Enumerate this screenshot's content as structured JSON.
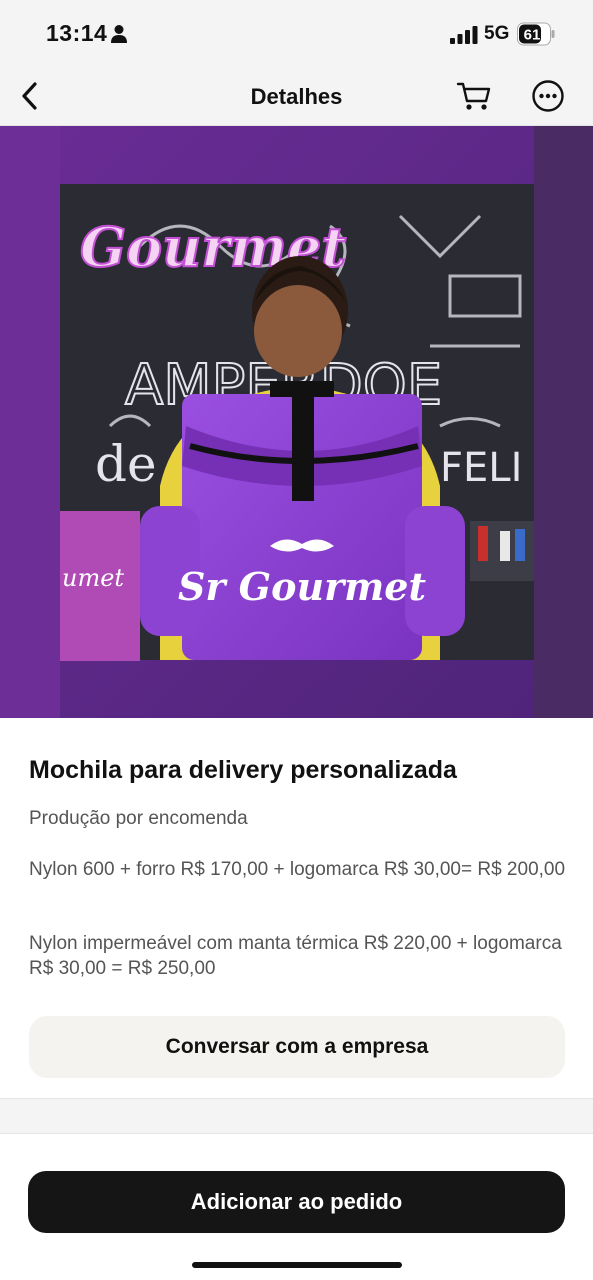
{
  "status_bar": {
    "time": "13:14",
    "network": "5G",
    "battery": "61"
  },
  "nav": {
    "title": "Detalhes"
  },
  "icons": {
    "back": "chevron-left-icon",
    "cart": "cart-icon",
    "more": "more-horizontal-icon",
    "person": "person-icon",
    "signal": "signal-icon",
    "battery": "battery-icon"
  },
  "product": {
    "image_texts": {
      "sign_top": "Gourmet",
      "chalk_line": "AMPERDOE",
      "chalk_de": "de",
      "chalk_feli": "FELI",
      "shirt": "umet",
      "bag_logo": "Sr Gourmet"
    },
    "title": "Mochila para delivery personalizada",
    "subtitle": "Produção por encomenda",
    "description_1": "Nylon 600 + forro  R$ 170,00 + logomarca R$ 30,00= R$ 200,00",
    "description_2": "Nylon  impermeável com manta térmica  R$ 220,00 + logomarca  R$ 30,00 = R$ 250,00"
  },
  "actions": {
    "chat_label": "Conversar com a empresa",
    "add_label": "Adicionar ao pedido"
  },
  "colors": {
    "purple_bg": "#5b2a86",
    "bag_purple": "#8a3fd1",
    "button_dark": "#151515",
    "chat_bg": "#f5f3ef"
  }
}
